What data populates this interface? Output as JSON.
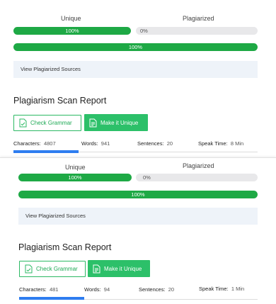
{
  "panels": [
    {
      "unique_label": "Unique",
      "plagiarized_label": "Plagiarized",
      "unique_percent": "100%",
      "plagiarized_percent": "0%",
      "unique_fraction": 1.0,
      "overall_percent": "100%",
      "overall_fraction": 1.0,
      "sources_label": "View Plagiarized Sources",
      "report_title": "Plagiarism Scan Report",
      "check_grammar_label": "Check Grammar",
      "make_unique_label": "Make it Unique",
      "stats": {
        "characters_label": "Characters:",
        "characters_value": "4807",
        "words_label": "Words:",
        "words_value": "941",
        "sentences_label": "Sentences:",
        "sentences_value": "20",
        "speak_label": "Speak Time:",
        "speak_value": "8 Min"
      }
    },
    {
      "unique_label": "Unique",
      "plagiarized_label": "Plagiarized",
      "unique_percent": "100%",
      "plagiarized_percent": "0%",
      "unique_fraction": 1.0,
      "overall_percent": "100%",
      "overall_fraction": 1.0,
      "sources_label": "View Plagiarized Sources",
      "report_title": "Plagiarism Scan Report",
      "check_grammar_label": "Check Grammar",
      "make_unique_label": "Make it Unique",
      "stats": {
        "characters_label": "Characters:",
        "characters_value": "481",
        "words_label": "Words:",
        "words_value": "94",
        "sentences_label": "Sentences:",
        "sentences_value": "20",
        "speak_label": "Speak Time:",
        "speak_value": "1 Min"
      }
    }
  ],
  "colors": {
    "green": "#1ea945",
    "button_green": "#2cc069",
    "blue": "#2e7df0",
    "sources_bg": "#eef3f9"
  },
  "icons": {
    "check_grammar": "document-check-icon",
    "make_unique": "document-edit-icon"
  }
}
